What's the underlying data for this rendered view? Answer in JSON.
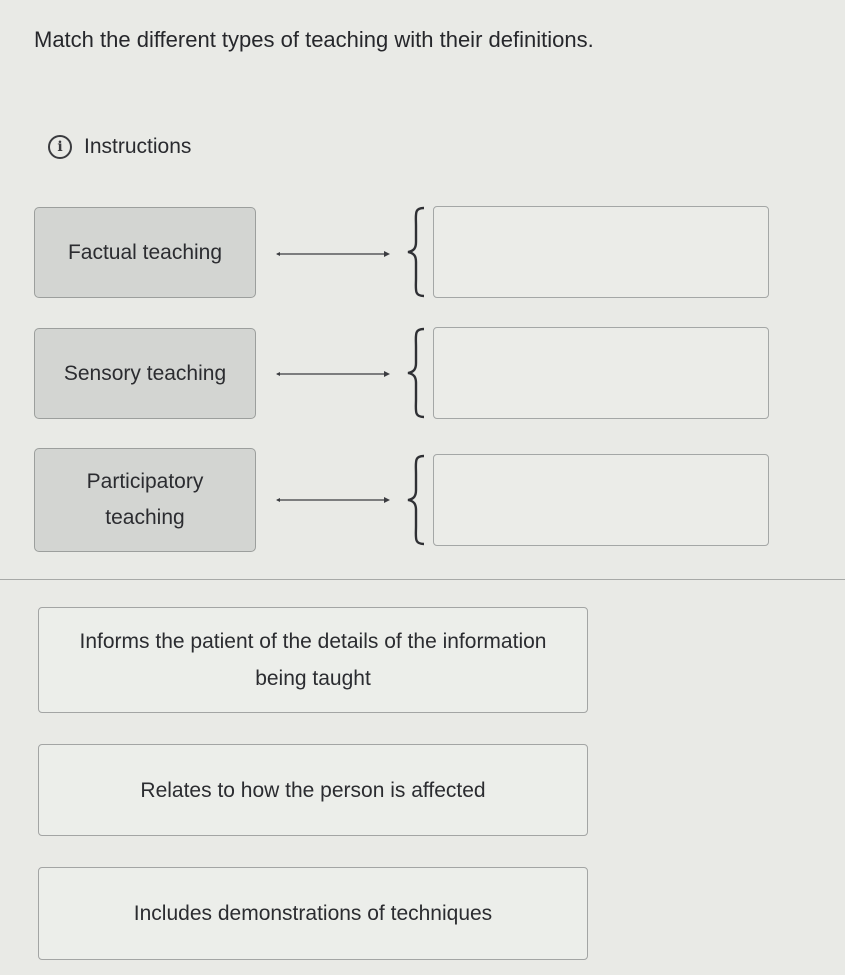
{
  "question": {
    "text": "Match the different types of teaching with their definitions."
  },
  "instructions": {
    "label": "Instructions",
    "icon": "info-icon"
  },
  "terms": [
    {
      "label": "Factual teaching"
    },
    {
      "label": "Sensory teaching"
    },
    {
      "label": "Participatory teaching"
    }
  ],
  "drop_slots": [
    {
      "value": ""
    },
    {
      "value": ""
    },
    {
      "value": ""
    }
  ],
  "definitions": [
    {
      "label": "Informs the patient of the details of the information being taught"
    },
    {
      "label": "Relates to how the person is affected"
    },
    {
      "label": "Includes demonstrations of techniques"
    }
  ]
}
